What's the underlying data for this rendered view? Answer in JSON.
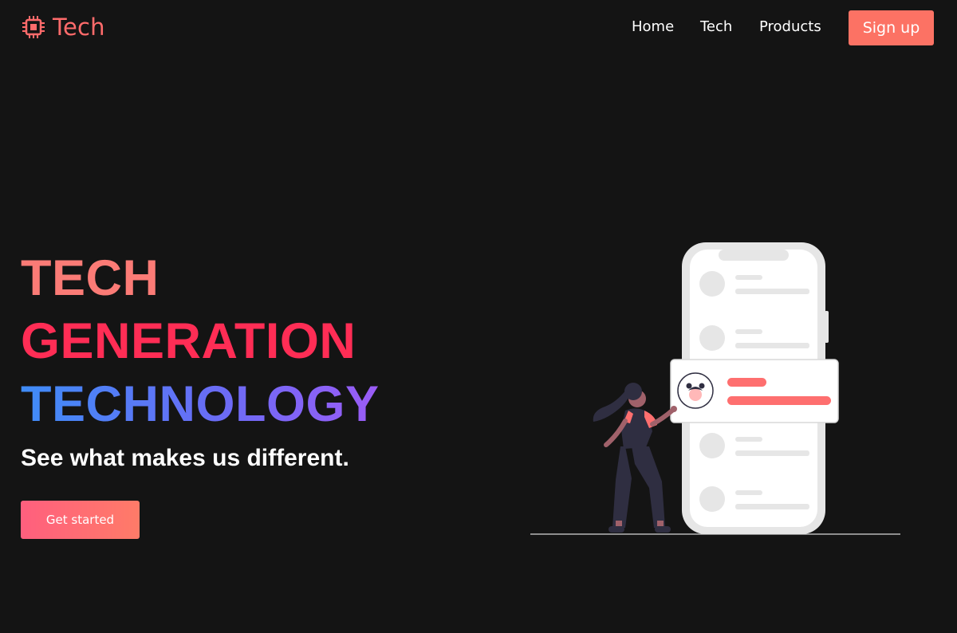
{
  "header": {
    "logo_text": "Tech",
    "nav": [
      {
        "label": "Home"
      },
      {
        "label": "Tech"
      },
      {
        "label": "Products"
      }
    ],
    "signup_label": "Sign up"
  },
  "hero": {
    "title_lines": [
      "TECH",
      "GENERATION",
      "TECHNOLOGY"
    ],
    "subtitle": "See what makes us different.",
    "cta_label": "Get started"
  },
  "icons": {
    "logo": "chip-icon"
  },
  "colors": {
    "background": "#141414",
    "accent": "#fc7264",
    "title_line_1": "#fb7b76",
    "title_line_2": "#ff2d55",
    "title_line_3_start": "#3f8cf7",
    "title_line_3_end": "#9b5cf6"
  }
}
